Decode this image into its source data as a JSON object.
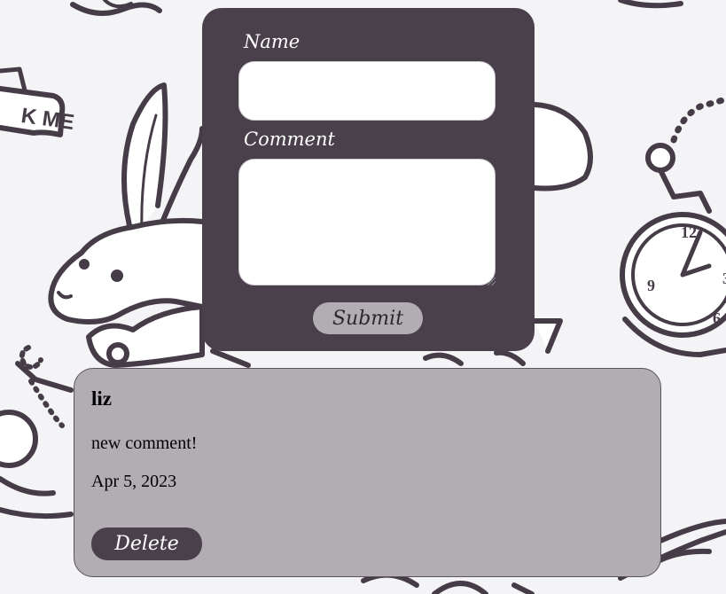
{
  "background": {
    "pattern": "alice-in-wonderland-doodles",
    "line_color": "#453c48",
    "sign_text": "K ME",
    "clock_numerals": [
      "12",
      "3",
      "9",
      "6"
    ]
  },
  "form": {
    "name_label": "Name",
    "name_value": "",
    "comment_label": "Comment",
    "comment_value": "",
    "submit_label": "Submit"
  },
  "comments": [
    {
      "author": "liz",
      "text": "new comment!",
      "date": "Apr 5, 2023",
      "delete_label": "Delete"
    }
  ],
  "colors": {
    "form_bg": "#4a404b",
    "card_bg": "#b1adb3",
    "button_light": "#b1adb3",
    "button_dark": "#4a404b"
  }
}
